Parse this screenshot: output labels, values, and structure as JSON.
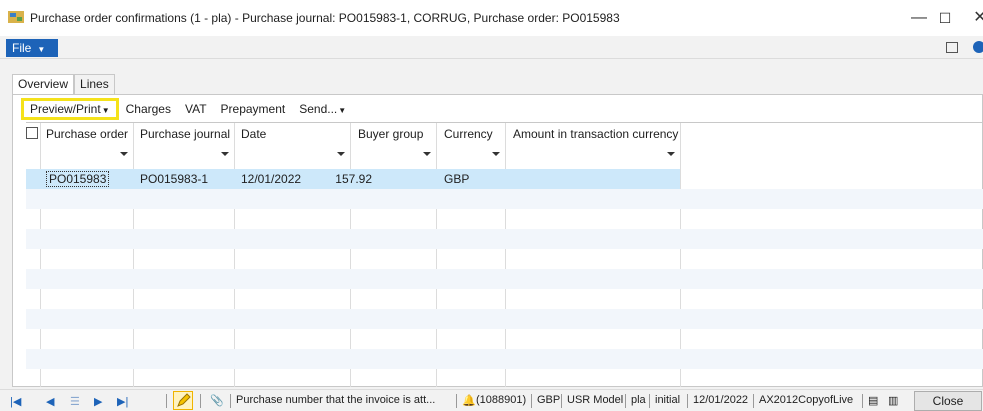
{
  "window": {
    "title": "Purchase order confirmations (1 - pla) - Purchase journal: PO015983-1, CORRUG, Purchase order: PO015983",
    "minimize_glyph": "—",
    "maximize_glyph": "☐",
    "close_glyph": "✕"
  },
  "menubar": {
    "file_label": "File"
  },
  "tabs": [
    {
      "label": "Overview",
      "active": true
    },
    {
      "label": "Lines",
      "active": false
    }
  ],
  "actions": {
    "preview_print": "Preview/Print",
    "charges": "Charges",
    "vat": "VAT",
    "prepayment": "Prepayment",
    "send": "Send..."
  },
  "grid": {
    "columns": [
      "Purchase order",
      "Purchase journal",
      "Date",
      "Buyer group",
      "Currency",
      "Amount in transaction currency"
    ],
    "rows": [
      {
        "purchase_order": "PO015983",
        "purchase_journal": "PO015983-1",
        "date": "12/01/2022",
        "buyer_group": "",
        "currency": "GBP",
        "amount": "157.92",
        "selected": true
      }
    ]
  },
  "statusbar": {
    "help_text": "Purchase number that the invoice is att...",
    "notifications": "(1088901)",
    "currency": "GBP",
    "user_model": "USR Model",
    "company": "pla",
    "layer": "initial",
    "session_date": "12/01/2022",
    "environment": "AX2012CopyofLive",
    "close_label": "Close"
  },
  "colors": {
    "accent": "#1d63b8",
    "highlight_box": "#f5e21a",
    "selected_row": "#cde8fa"
  }
}
